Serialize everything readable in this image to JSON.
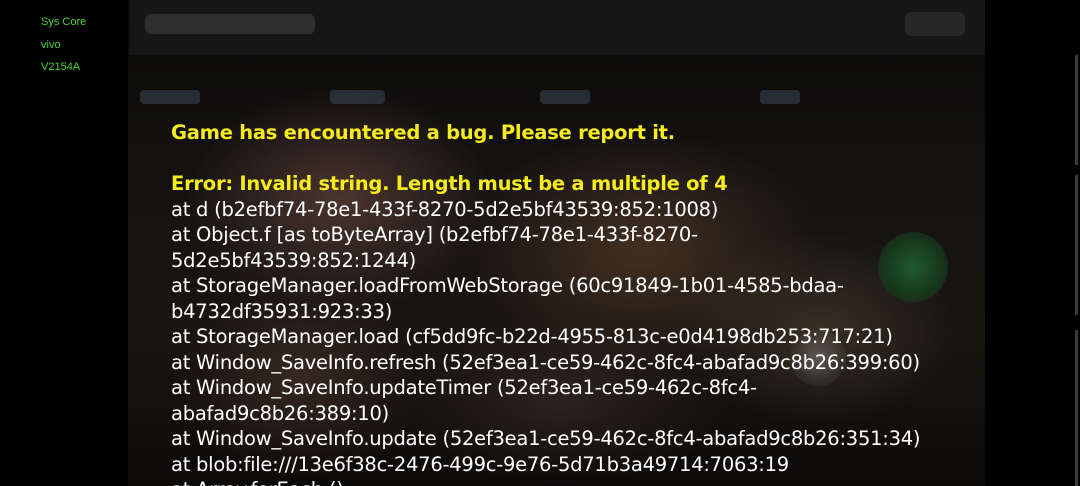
{
  "device": {
    "app_name": "Sys Core",
    "brand": "vivo",
    "model": "V2154A"
  },
  "error": {
    "headline": "Game has encountered a bug. Please report it.",
    "title": "Error: Invalid string. Length must be a multiple of 4",
    "stack": [
      "at d (b2efbf74-78e1-433f-8270-5d2e5bf43539:852:1008)",
      "at Object.f [as toByteArray] (b2efbf74-78e1-433f-8270-",
      "5d2e5bf43539:852:1244)",
      "at StorageManager.loadFromWebStorage (60c91849-1b01-4585-bdaa-",
      "b4732df35931:923:33)",
      "at StorageManager.load (cf5dd9fc-b22d-4955-813c-e0d4198db253:717:21)",
      "at Window_SaveInfo.refresh (52ef3ea1-ce59-462c-8fc4-abafad9c8b26:399:60)",
      "at Window_SaveInfo.updateTimer (52ef3ea1-ce59-462c-8fc4-",
      "abafad9c8b26:389:10)",
      "at Window_SaveInfo.update (52ef3ea1-ce59-462c-8fc4-abafad9c8b26:351:34)",
      "at blob:file:///13e6f38c-2476-499c-9e76-5d71b3a49714:7063:19",
      "at Array.forEach ()"
    ]
  },
  "colors": {
    "device_info": "#4cd43a",
    "error_highlight": "#f6eb1c",
    "stack_text": "#ffffff",
    "background": "#000000"
  },
  "icons": {
    "game_action_button": "green-circle-button",
    "game_secondary_button": "grey-circle-button"
  }
}
